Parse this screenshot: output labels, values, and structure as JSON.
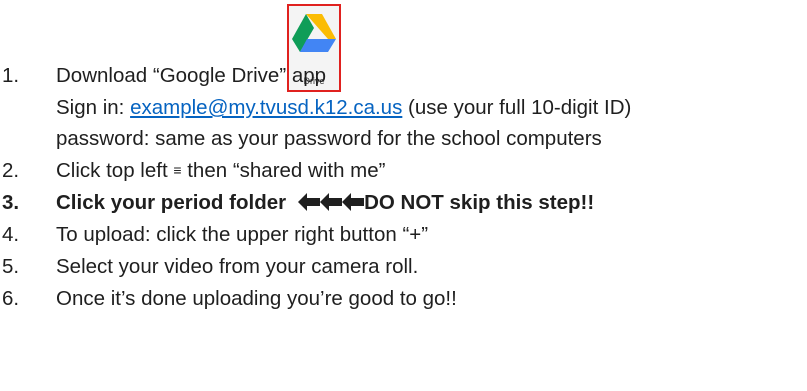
{
  "app_tile": {
    "icon": "google-drive-icon",
    "caption": "Drive",
    "colors": {
      "frame": "#e0211f",
      "yellow": "#fbbc04",
      "green": "#0f9d58",
      "blue": "#4285f4"
    }
  },
  "steps": [
    {
      "number": "1.",
      "text": "Download “Google Drive” app",
      "sub": {
        "sign_in_label": "Sign in: ",
        "sign_in_link": "example@my.tvusd.k12.ca.us",
        "sign_in_note": " (use your full 10-digit ID)",
        "password_line": "password: same as your password for the school computers"
      }
    },
    {
      "number": "2.",
      "text_before": "Click top left ",
      "menu_glyph": "≡",
      "text_after": " then “shared with me”"
    },
    {
      "number": "3.",
      "text_before": "Click your period folder",
      "arrow_icon": "left-arrow-icon",
      "text_after": "DO NOT skip this step!!"
    },
    {
      "number": "4.",
      "text": "To upload: click the upper right button “+”"
    },
    {
      "number": "5.",
      "text": "Select your video from your camera roll."
    },
    {
      "number": "6.",
      "text": "Once it’s done uploading you’re good to go!!"
    }
  ]
}
